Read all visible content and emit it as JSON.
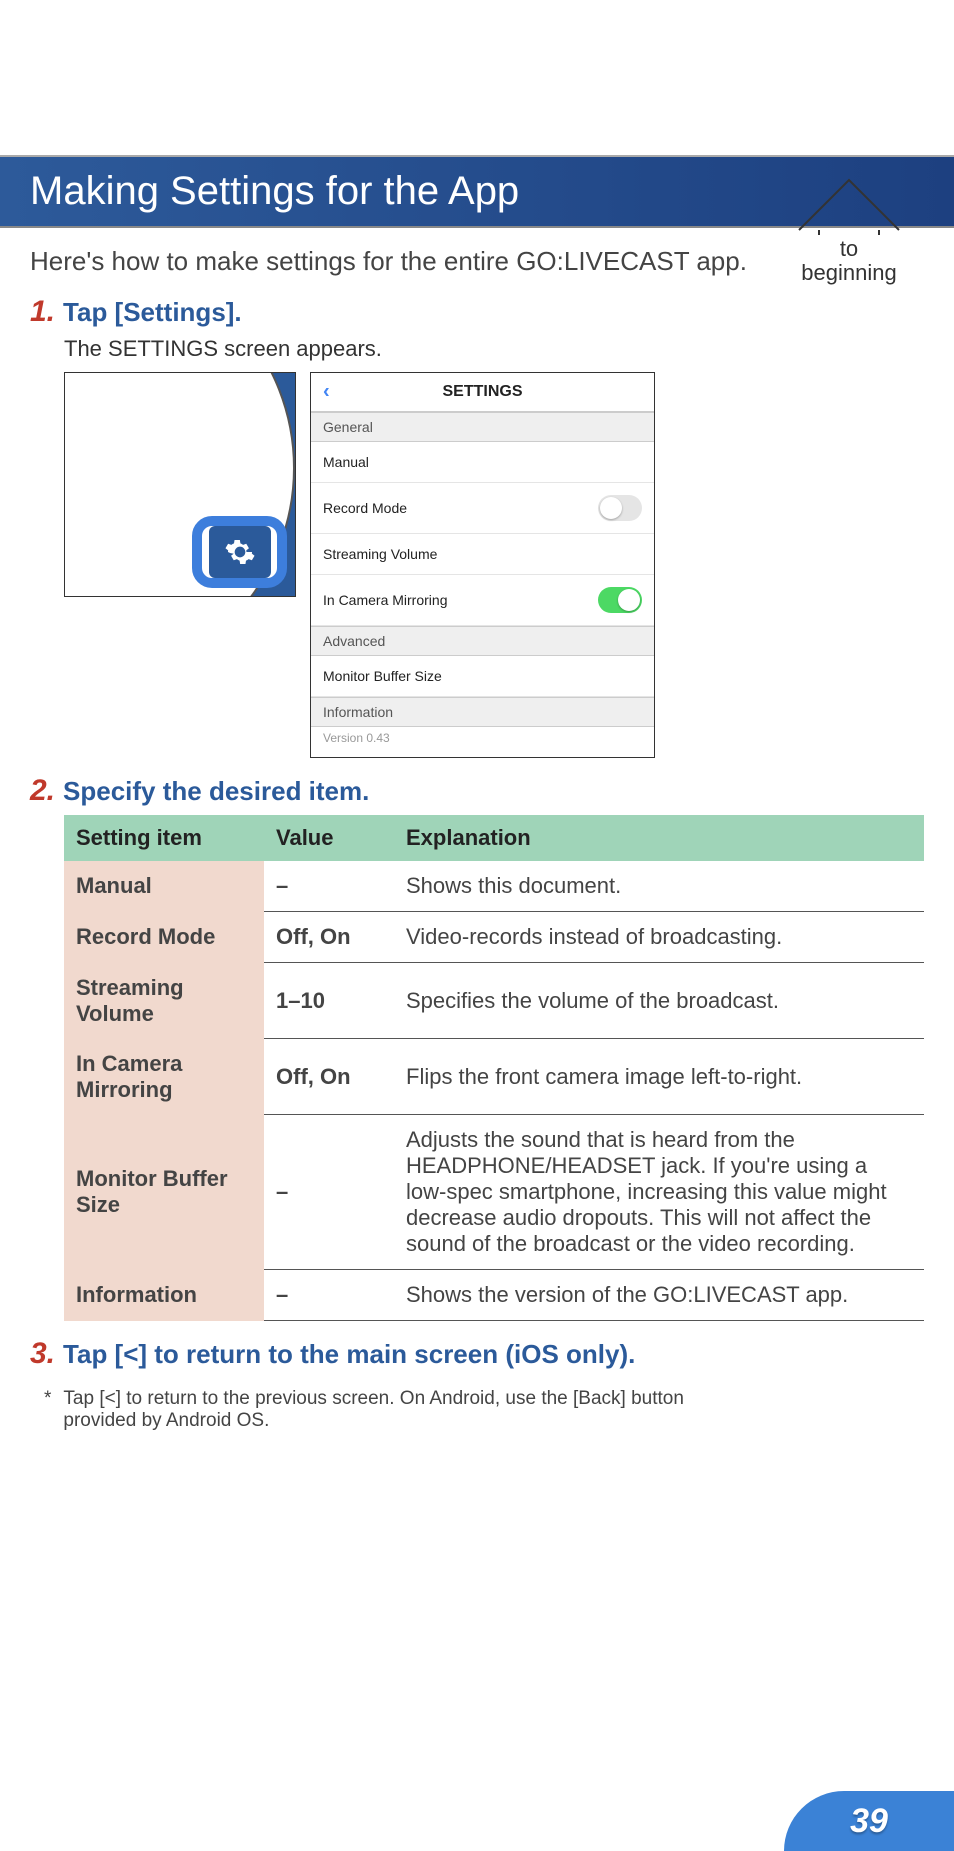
{
  "nav": {
    "line1": "to",
    "line2": "beginning"
  },
  "title": "Making Settings for the App",
  "intro": "Here's how to make settings for the entire GO:LIVECAST app.",
  "step1": {
    "num": "1.",
    "title": "Tap [Settings].",
    "sub": "The SETTINGS screen appears."
  },
  "settings_screen": {
    "header": "SETTINGS",
    "back": "‹",
    "sections": {
      "general": "General",
      "advanced": "Advanced",
      "information": "Information"
    },
    "rows": {
      "manual": "Manual",
      "record_mode": "Record Mode",
      "streaming_volume": "Streaming Volume",
      "in_camera_mirroring": "In Camera Mirroring",
      "monitor_buffer": "Monitor Buffer Size",
      "version": "Version 0.43"
    }
  },
  "step2": {
    "num": "2.",
    "title": "Specify the desired item."
  },
  "table": {
    "headers": {
      "item": "Setting item",
      "value": "Value",
      "explanation": "Explanation"
    },
    "rows": [
      {
        "name": "Manual",
        "value": "–",
        "exp": "Shows this document."
      },
      {
        "name": "Record Mode",
        "value": "Off, On",
        "exp": "Video-records instead of broadcasting."
      },
      {
        "name": "Streaming Volume",
        "value": "1–10",
        "exp": "Specifies the volume of the broadcast."
      },
      {
        "name": "In Camera Mirroring",
        "value": "Off, On",
        "exp": "Flips the front camera image left-to-right."
      },
      {
        "name": "Monitor Buffer Size",
        "value": "–",
        "exp": "Adjusts the sound that is heard from the HEADPHONE/HEADSET jack. If you're using a low-spec smartphone, increasing this value might decrease audio dropouts. This will not affect the sound of the broadcast or the video recording."
      },
      {
        "name": "Information",
        "value": "–",
        "exp": "Shows the version of the GO:LIVECAST app."
      }
    ]
  },
  "step3": {
    "num": "3.",
    "title": "Tap [<] to return to the main screen (iOS only)."
  },
  "footnote": {
    "ast": "*",
    "text": "Tap [<] to return to the previous screen. On Android, use the [Back] button provided by Android OS."
  },
  "page_num": "39",
  "chart_data": {
    "type": "table",
    "title": "Setting items",
    "columns": [
      "Setting item",
      "Value",
      "Explanation"
    ],
    "rows": [
      [
        "Manual",
        "–",
        "Shows this document."
      ],
      [
        "Record Mode",
        "Off, On",
        "Video-records instead of broadcasting."
      ],
      [
        "Streaming Volume",
        "1–10",
        "Specifies the volume of the broadcast."
      ],
      [
        "In Camera Mirroring",
        "Off, On",
        "Flips the front camera image left-to-right."
      ],
      [
        "Monitor Buffer Size",
        "–",
        "Adjusts the sound that is heard from the HEADPHONE/HEADSET jack. If you're using a low-spec smartphone, increasing this value might decrease audio dropouts. This will not affect the sound of the broadcast or the video recording."
      ],
      [
        "Information",
        "–",
        "Shows the version of the GO:LIVECAST app."
      ]
    ]
  }
}
